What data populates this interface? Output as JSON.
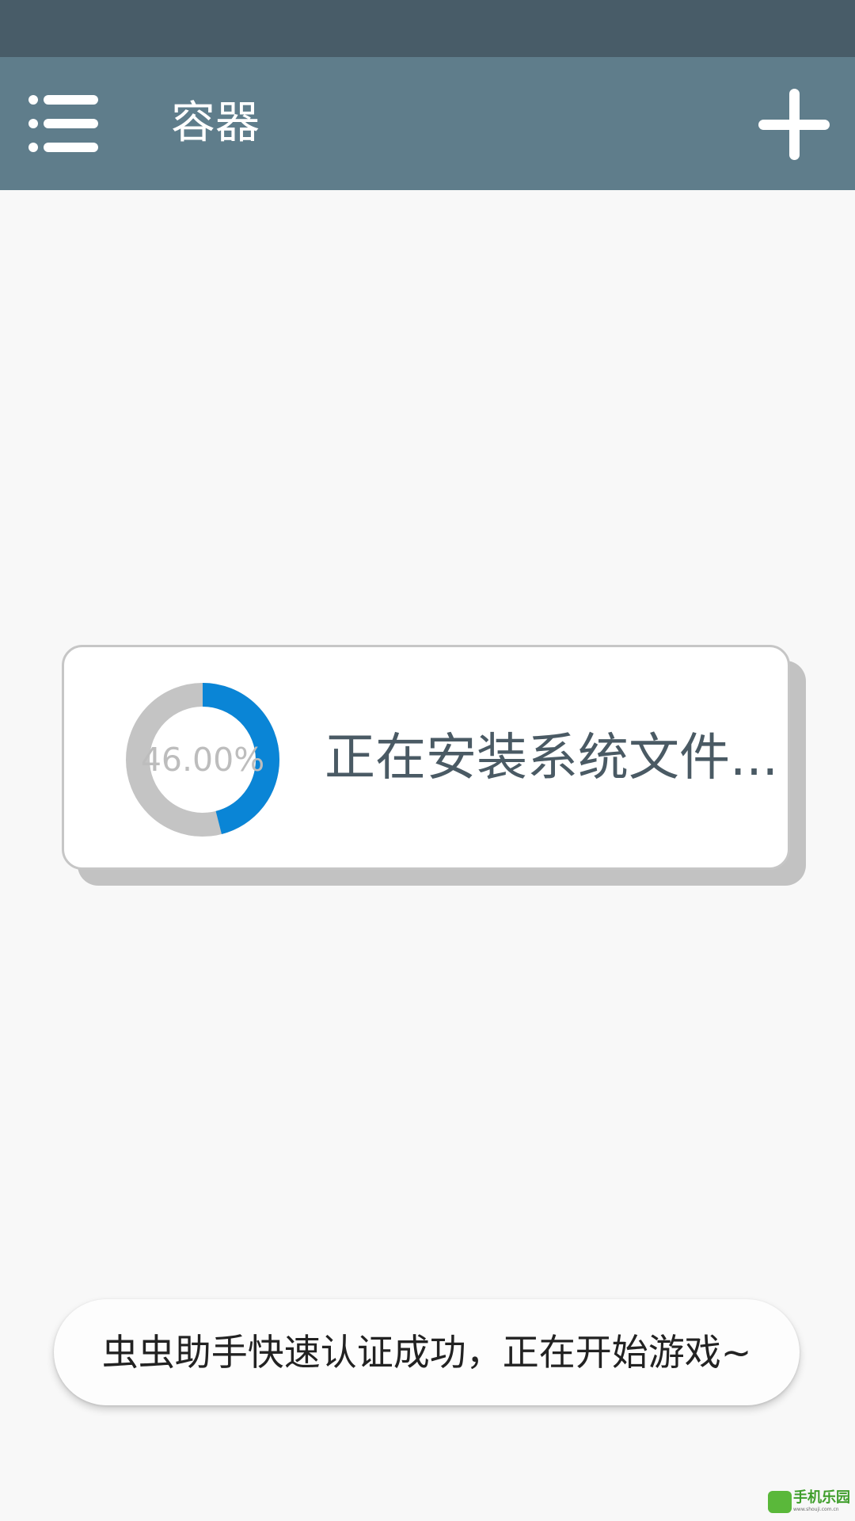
{
  "app_bar": {
    "title": "容器",
    "menu_icon": "menu-list-icon",
    "add_icon": "plus-icon",
    "background": "#5f7d8b",
    "status_bar_color": "#485c68"
  },
  "install_dialog": {
    "progress_percent": 46,
    "progress_label": "46.00%",
    "message": "正在安装系统文件...",
    "progress_color": "#0a85d6",
    "track_color": "#c4c4c4"
  },
  "toast": {
    "message": "虫虫助手快速认证成功，正在开始游戏~"
  },
  "watermark": {
    "text": "手机乐园",
    "url": "www.shouji.com.cn"
  }
}
